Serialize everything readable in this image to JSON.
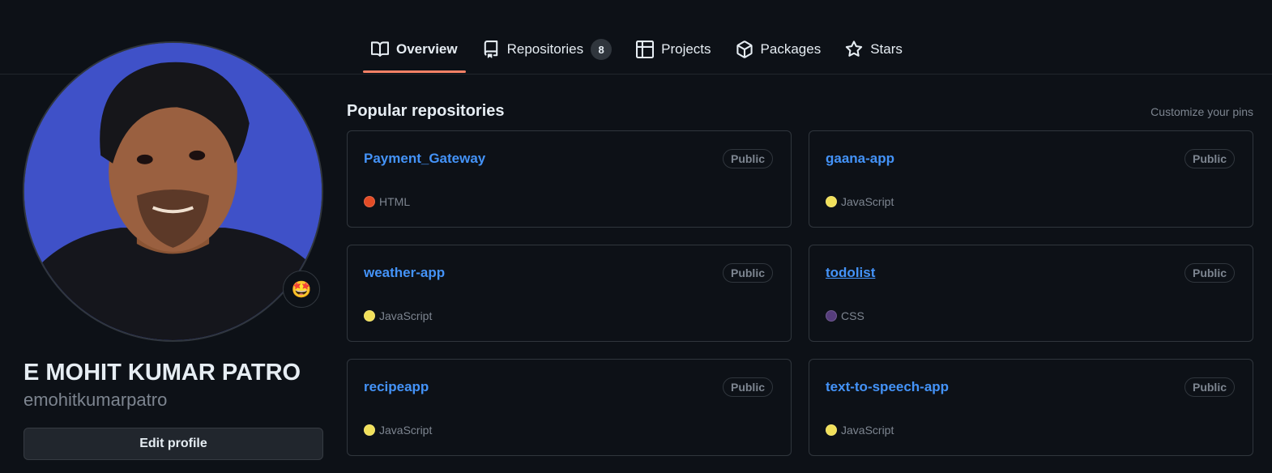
{
  "tabs": [
    {
      "label": "Overview",
      "icon": "book-icon",
      "selected": true
    },
    {
      "label": "Repositories",
      "icon": "repo-icon",
      "count": "8"
    },
    {
      "label": "Projects",
      "icon": "table-icon"
    },
    {
      "label": "Packages",
      "icon": "package-icon"
    },
    {
      "label": "Stars",
      "icon": "star-icon"
    }
  ],
  "profile": {
    "full_name": "E MOHIT KUMAR PATRO",
    "login": "emohitkumarpatro",
    "edit_label": "Edit profile",
    "status_emoji": "🤩"
  },
  "popular": {
    "title": "Popular repositories",
    "customize_label": "Customize your pins",
    "repos": [
      {
        "name": "Payment_Gateway",
        "visibility": "Public",
        "language": "HTML",
        "color": "#e34c26"
      },
      {
        "name": "gaana-app",
        "visibility": "Public",
        "language": "JavaScript",
        "color": "#f1e05a"
      },
      {
        "name": "weather-app",
        "visibility": "Public",
        "language": "JavaScript",
        "color": "#f1e05a"
      },
      {
        "name": "todolist",
        "visibility": "Public",
        "language": "CSS",
        "color": "#563d7c"
      },
      {
        "name": "recipeapp",
        "visibility": "Public",
        "language": "JavaScript",
        "color": "#f1e05a"
      },
      {
        "name": "text-to-speech-app",
        "visibility": "Public",
        "language": "JavaScript",
        "color": "#f1e05a"
      }
    ]
  },
  "colors": {
    "background": "#0d1117",
    "link": "#4493f8",
    "tab_underline": "#f78166",
    "border": "#30363d"
  }
}
